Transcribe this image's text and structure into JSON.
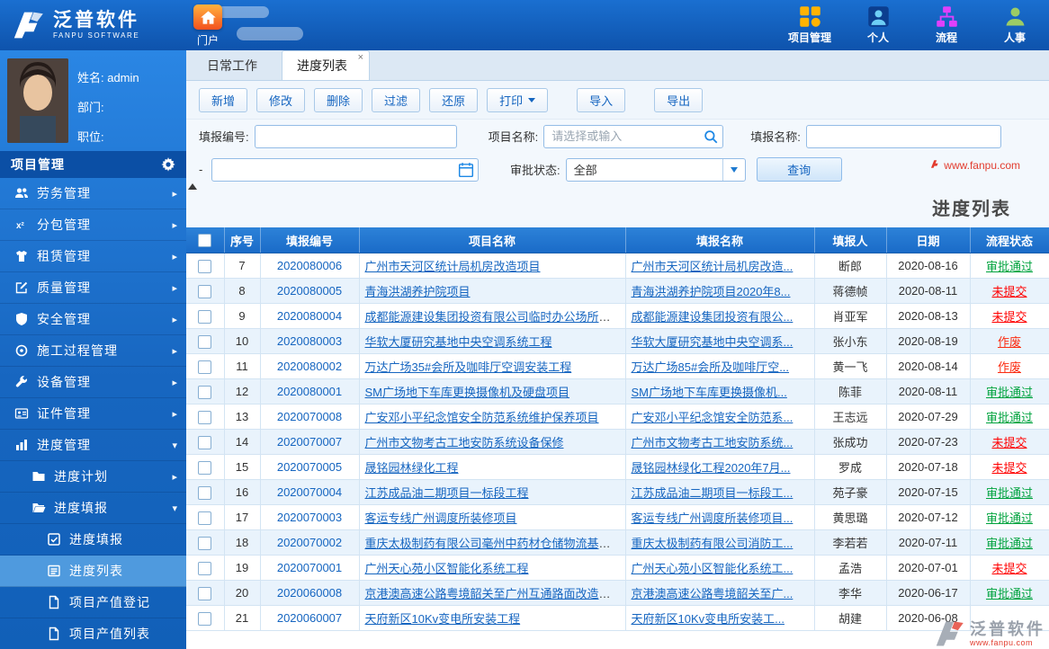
{
  "colors": {
    "accent": "#1565c0",
    "header_blue": "#0e53ac",
    "sidebar_blue": "#1766c0",
    "table_header_blue": "#1a6bc8"
  },
  "header": {
    "logo": {
      "title": "泛普软件",
      "subtitle": "FANPU SOFTWARE"
    },
    "portal": {
      "label": "门户",
      "icon": "house"
    },
    "nav_items": [
      {
        "id": "project",
        "label": "项目管理",
        "icon": "grid"
      },
      {
        "id": "personal",
        "label": "个人",
        "icon": "user"
      },
      {
        "id": "flow",
        "label": "流程",
        "icon": "flow"
      },
      {
        "id": "hr",
        "label": "人事",
        "icon": "staff"
      }
    ]
  },
  "sidebar": {
    "profile": {
      "name": "姓名: admin",
      "department": "部门:",
      "position": "职位:"
    },
    "section": {
      "label": "项目管理",
      "icon": "gear"
    },
    "menu": [
      {
        "id": "labor",
        "label": "劳务管理",
        "icon": "users",
        "level": 0
      },
      {
        "id": "subcontract",
        "label": "分包管理",
        "icon": "x2",
        "level": 0
      },
      {
        "id": "lease",
        "label": "租赁管理",
        "icon": "shirt",
        "level": 0
      },
      {
        "id": "quality",
        "label": "质量管理",
        "icon": "edit",
        "level": 0
      },
      {
        "id": "safety",
        "label": "安全管理",
        "icon": "shield",
        "level": 0
      },
      {
        "id": "construction",
        "label": "施工过程管理",
        "icon": "target",
        "level": 0
      },
      {
        "id": "equipment",
        "label": "设备管理",
        "icon": "wrench",
        "level": 0
      },
      {
        "id": "certificate",
        "label": "证件管理",
        "icon": "idcard",
        "level": 0
      },
      {
        "id": "progress",
        "label": "进度管理",
        "icon": "chart",
        "level": 0,
        "expanded": true
      },
      {
        "id": "progress-plan",
        "label": "进度计划",
        "icon": "folder",
        "level": 1
      },
      {
        "id": "progress-report",
        "label": "进度填报",
        "icon": "folder-open",
        "level": 1,
        "expanded": true
      },
      {
        "id": "progress-report-entry",
        "label": "进度填报",
        "icon": "edit-check",
        "level": 2,
        "leaf": true
      },
      {
        "id": "progress-list",
        "label": "进度列表",
        "icon": "list",
        "level": 2,
        "leaf": true,
        "active": true
      },
      {
        "id": "output-register",
        "label": "项目产值登记",
        "icon": "doc",
        "level": 2,
        "leaf": true
      },
      {
        "id": "output-list",
        "label": "项目产值列表",
        "icon": "doc",
        "level": 2,
        "leaf": true
      }
    ]
  },
  "tabs": {
    "close_symbol": "×",
    "items": [
      {
        "id": "daily-work",
        "label": "日常工作"
      },
      {
        "id": "progress-list",
        "label": "进度列表",
        "active": true,
        "closable": true
      }
    ]
  },
  "toolbar": {
    "buttons": [
      {
        "id": "add",
        "label": "新增"
      },
      {
        "id": "edit",
        "label": "修改"
      },
      {
        "id": "delete",
        "label": "删除"
      },
      {
        "id": "filter",
        "label": "过滤"
      },
      {
        "id": "restore",
        "label": "还原"
      },
      {
        "id": "print",
        "label": "打印",
        "caret": true
      },
      {
        "id": "import",
        "label": "导入",
        "gap": true
      },
      {
        "id": "export",
        "label": "导出",
        "gap": true
      }
    ]
  },
  "filters": {
    "report_no_label": "填报编号:",
    "report_no_value": "",
    "project_name_label": "项目名称:",
    "project_name_placeholder": "请选择或输入",
    "project_name_icon": "magnifier",
    "report_name_label": "填报名称:",
    "report_name_value": "",
    "date_separator": "-",
    "date_value": "",
    "date_icon": "calendar",
    "status_label": "审批状态:",
    "status_value": "全部",
    "query_button": "查询"
  },
  "content": {
    "title": "进度列表",
    "watermark_top": "www.fanpu.com",
    "watermark_bottom": {
      "text": "泛普软件",
      "url": "www.fanpu.com"
    }
  },
  "table": {
    "columns": [
      "序号",
      "填报编号",
      "项目名称",
      "填报名称",
      "填报人",
      "日期",
      "流程状态"
    ],
    "status_colors": {
      "approved": "#00a33e",
      "unsubmitted": "#ff0000",
      "voided": "#fb2d12"
    },
    "rows": [
      {
        "seq": 7,
        "code": "2020080006",
        "project": "广州市天河区统计局机房改造项目",
        "report": "广州市天河区统计局机房改造...",
        "person": "断郎",
        "date": "2020-08-16",
        "status": "审批通过",
        "status_type": "approved"
      },
      {
        "seq": 8,
        "code": "2020080005",
        "project": "青海洪湖养护院项目",
        "report": "青海洪湖养护院项目2020年8...",
        "person": "蒋德帧",
        "date": "2020-08-11",
        "status": "未提交",
        "status_type": "unsubmitted"
      },
      {
        "seq": 9,
        "code": "2020080004",
        "project": "成都能源建设集团投资有限公司临时办公场所装...",
        "report": "成都能源建设集团投资有限公...",
        "person": "肖亚军",
        "date": "2020-08-13",
        "status": "未提交",
        "status_type": "unsubmitted"
      },
      {
        "seq": 10,
        "code": "2020080003",
        "project": "华软大厦研究基地中央空调系统工程",
        "report": "华软大厦研究基地中央空调系...",
        "person": "张小东",
        "date": "2020-08-19",
        "status": "作废",
        "status_type": "voided"
      },
      {
        "seq": 11,
        "code": "2020080002",
        "project": "万达广场35#会所及咖啡厅空调安装工程",
        "report": "万达广场85#会所及咖啡厅空...",
        "person": "黄一飞",
        "date": "2020-08-14",
        "status": "作废",
        "status_type": "voided"
      },
      {
        "seq": 12,
        "code": "2020080001",
        "project": "SM广场地下车库更换摄像机及硬盘项目",
        "report": "SM广场地下车库更换摄像机...",
        "person": "陈菲",
        "date": "2020-08-11",
        "status": "审批通过",
        "status_type": "approved"
      },
      {
        "seq": 13,
        "code": "2020070008",
        "project": "广安邓小平纪念馆安全防范系统维护保养项目",
        "report": "广安邓小平纪念馆安全防范系...",
        "person": "王志远",
        "date": "2020-07-29",
        "status": "审批通过",
        "status_type": "approved"
      },
      {
        "seq": 14,
        "code": "2020070007",
        "project": "广州市文物考古工地安防系统设备保修",
        "report": "广州市文物考古工地安防系统...",
        "person": "张成功",
        "date": "2020-07-23",
        "status": "未提交",
        "status_type": "unsubmitted"
      },
      {
        "seq": 15,
        "code": "2020070005",
        "project": "晟铭园林绿化工程",
        "report": "晟铭园林绿化工程2020年7月...",
        "person": "罗成",
        "date": "2020-07-18",
        "status": "未提交",
        "status_type": "unsubmitted"
      },
      {
        "seq": 16,
        "code": "2020070004",
        "project": "江苏成品油二期项目一标段工程",
        "report": "江苏成品油二期项目一标段工...",
        "person": "苑子豪",
        "date": "2020-07-15",
        "status": "审批通过",
        "status_type": "approved"
      },
      {
        "seq": 17,
        "code": "2020070003",
        "project": "客运专线广州调度所装修项目",
        "report": "客运专线广州调度所装修项目...",
        "person": "黄思璐",
        "date": "2020-07-12",
        "status": "审批通过",
        "status_type": "approved"
      },
      {
        "seq": 18,
        "code": "2020070002",
        "project": "重庆太极制药有限公司毫州中药材仓储物流基地...",
        "report": "重庆太极制药有限公司消防工...",
        "person": "李若若",
        "date": "2020-07-11",
        "status": "审批通过",
        "status_type": "approved"
      },
      {
        "seq": 19,
        "code": "2020070001",
        "project": "广州天心苑小区智能化系统工程",
        "report": "广州天心苑小区智能化系统工...",
        "person": "孟浩",
        "date": "2020-07-01",
        "status": "未提交",
        "status_type": "unsubmitted"
      },
      {
        "seq": 20,
        "code": "2020060008",
        "project": "京港澳高速公路粤境韶关至广州互通路面改造中...",
        "report": "京港澳高速公路粤境韶关至广...",
        "person": "李华",
        "date": "2020-06-17",
        "status": "审批通过",
        "status_type": "approved"
      },
      {
        "seq": 21,
        "code": "2020060007",
        "project": "天府新区10Kv变电所安装工程",
        "report": "天府新区10Kv变电所安装工...",
        "person": "胡建",
        "date": "2020-06-08",
        "status": "",
        "status_type": "hidden"
      }
    ]
  }
}
